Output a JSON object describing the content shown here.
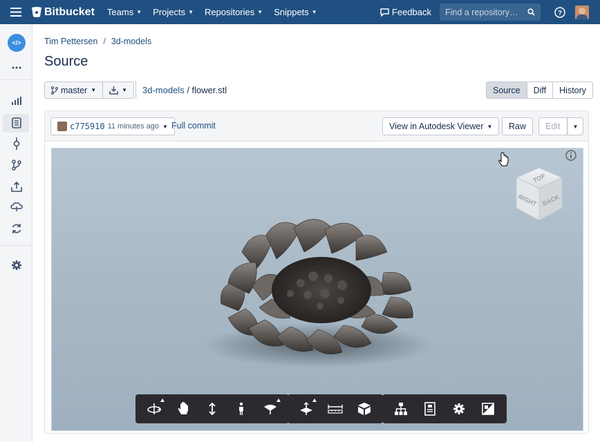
{
  "topnav": {
    "brand": "Bitbucket",
    "links": [
      {
        "label": "Teams"
      },
      {
        "label": "Projects"
      },
      {
        "label": "Repositories"
      },
      {
        "label": "Snippets"
      }
    ],
    "feedback_label": "Feedback",
    "search_placeholder": "Find a repository…",
    "colors": {
      "nav_bg": "#205081"
    }
  },
  "breadcrumb": {
    "owner": "Tim Pettersen",
    "separator": "/",
    "repo": "3d-models"
  },
  "page_title": "Source",
  "branch": {
    "label": "master"
  },
  "filepath": {
    "repo_link": "3d-models",
    "separator": " / ",
    "filename": "flower.stl"
  },
  "view_tabs": [
    {
      "label": "Source",
      "active": true
    },
    {
      "label": "Diff",
      "active": false
    },
    {
      "label": "History",
      "active": false
    }
  ],
  "commit": {
    "hash": "c775910",
    "time": "11 minutes ago",
    "full_commit_label": "Full commit"
  },
  "actions": {
    "viewer_label": "View in Autodesk Viewer",
    "raw_label": "Raw",
    "edit_label": "Edit"
  },
  "viewcube": {
    "top": "TOP",
    "right": "RIGHT",
    "back": "BACK"
  },
  "viewer_toolbar": {
    "group1": [
      "orbit-icon",
      "pan-icon",
      "zoom-icon",
      "first-person-icon",
      "camera-icon"
    ],
    "group2": [
      "explode-icon",
      "measure-icon",
      "section-icon"
    ],
    "group3": [
      "model-browser-icon",
      "properties-icon",
      "settings-icon",
      "fullscreen-icon"
    ]
  }
}
